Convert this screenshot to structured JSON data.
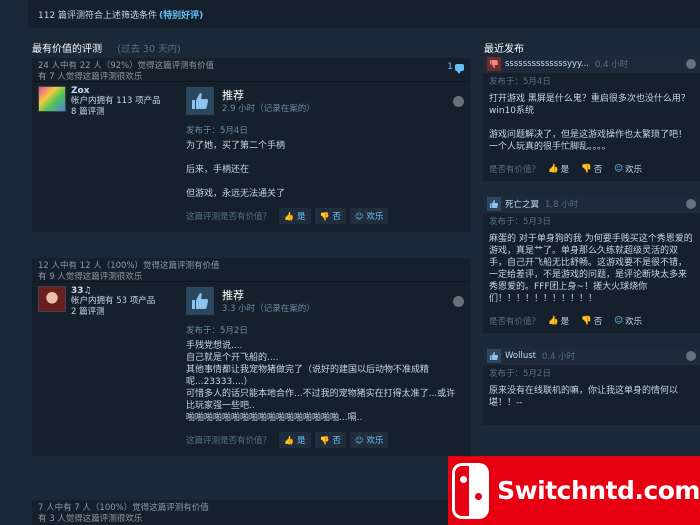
{
  "topbar": {
    "summary": "112 篇评测符合上述筛选条件",
    "rating": "(特别好评)"
  },
  "left_section": {
    "title": "最有价值的评测",
    "subtitle": "(过去 30 天内)"
  },
  "right_section": {
    "title": "最近发布"
  },
  "reviews": [
    {
      "helpful_line": "24 人中有 22 人（92%）觉得这篇评测有价值",
      "funny_line": "有 7 人觉得这篇评测很欢乐",
      "comment_count": "1",
      "author": "Zox",
      "products": "帐户内拥有 113 项产品",
      "review_count": "8 篇评测",
      "verdict": "推荐",
      "hours": "2.9 小时（记录在案的）",
      "posted": "发布于：5月4日",
      "text": [
        "为了她，买了第二个手柄",
        "后来，手柄还在",
        "但游戏，永远无法通关了"
      ],
      "helpful_q": "这篇评测是否有价值？",
      "yes": "是",
      "no": "否",
      "funny": "欢乐"
    },
    {
      "helpful_line": "12 人中有 12 人（100%）觉得这篇评测有价值",
      "funny_line": "有 9 人觉得这篇评测很欢乐",
      "author": "33♫",
      "products": "帐户内拥有 53 项产品",
      "review_count": "2 篇评测",
      "verdict": "推荐",
      "hours": "3.3 小时（记录在案的）",
      "posted": "发布于：5月2日",
      "text": "手残党想说....\n自己就是个开飞船的....\n其他事情都让我宠物猪做完了（说好的建国以后动物不准成精呢...23333....）\n可惜多人的话只能本地合作...不过我的宠物猪实在打得太准了...或许比玩家强一些吧..\n啪啪啪啪啪啪啪啪啪啪啪啪啪啪啪啪啪...嗝..",
      "helpful_q": "这篇评测是否有价值？",
      "yes": "是",
      "no": "否",
      "funny": "欢乐"
    }
  ],
  "review3_partial": {
    "helpful_line": "7 人中有 7 人（100%）觉得这篇评测有价值",
    "funny_line": "有 3 人觉得这篇评测很欢乐"
  },
  "recent": [
    {
      "name": "ssssssssssssssyyy...",
      "hours": "0.4 小时",
      "posted": "发布于：5月4日",
      "paragraphs": [
        "打开游戏 黑屏是什么鬼？重启很多次也没什么用？win10系统",
        "游戏问题解决了，但是这游戏操作也太繁琐了吧！一个人玩真的很手忙脚乱。。。。"
      ],
      "helpful_q": "是否有价值？",
      "yes": "是",
      "no": "否",
      "funny": "欢乐"
    },
    {
      "name": "死亡之翼",
      "hours": "1.8 小时",
      "posted": "发布于：5月3日",
      "paragraphs": [
        "麻蛋的 对于单身狗的我 为何要手贱买这个秀恩爱的游戏，真是艹了。单身那么久练就超级灵活的双手，自己开飞船无比舒畅。这游戏要不是很不错，一定给差评，不是游戏的问题，是评论断块太多来秀恩爱的。FFF团上身~！搓大火球烧你们！！！！！！！！！！！"
      ],
      "helpful_q": "是否有价值？",
      "yes": "是",
      "no": "否",
      "funny": "欢乐"
    },
    {
      "name": "Wollust",
      "hours": "0.4 小时",
      "posted": "发布于：5月2日",
      "paragraphs": [
        "原来没有在线联机的嘛，你让我这单身的情何以堪！！--"
      ]
    }
  ],
  "banner": {
    "text": "Switchntd.com"
  },
  "colors": {
    "background": "#1b2838",
    "accent": "#66c0f4",
    "recommend_tile": "#2a475e",
    "not_recommend_tile": "#6d2d2d",
    "banner_red": "#e60012"
  }
}
